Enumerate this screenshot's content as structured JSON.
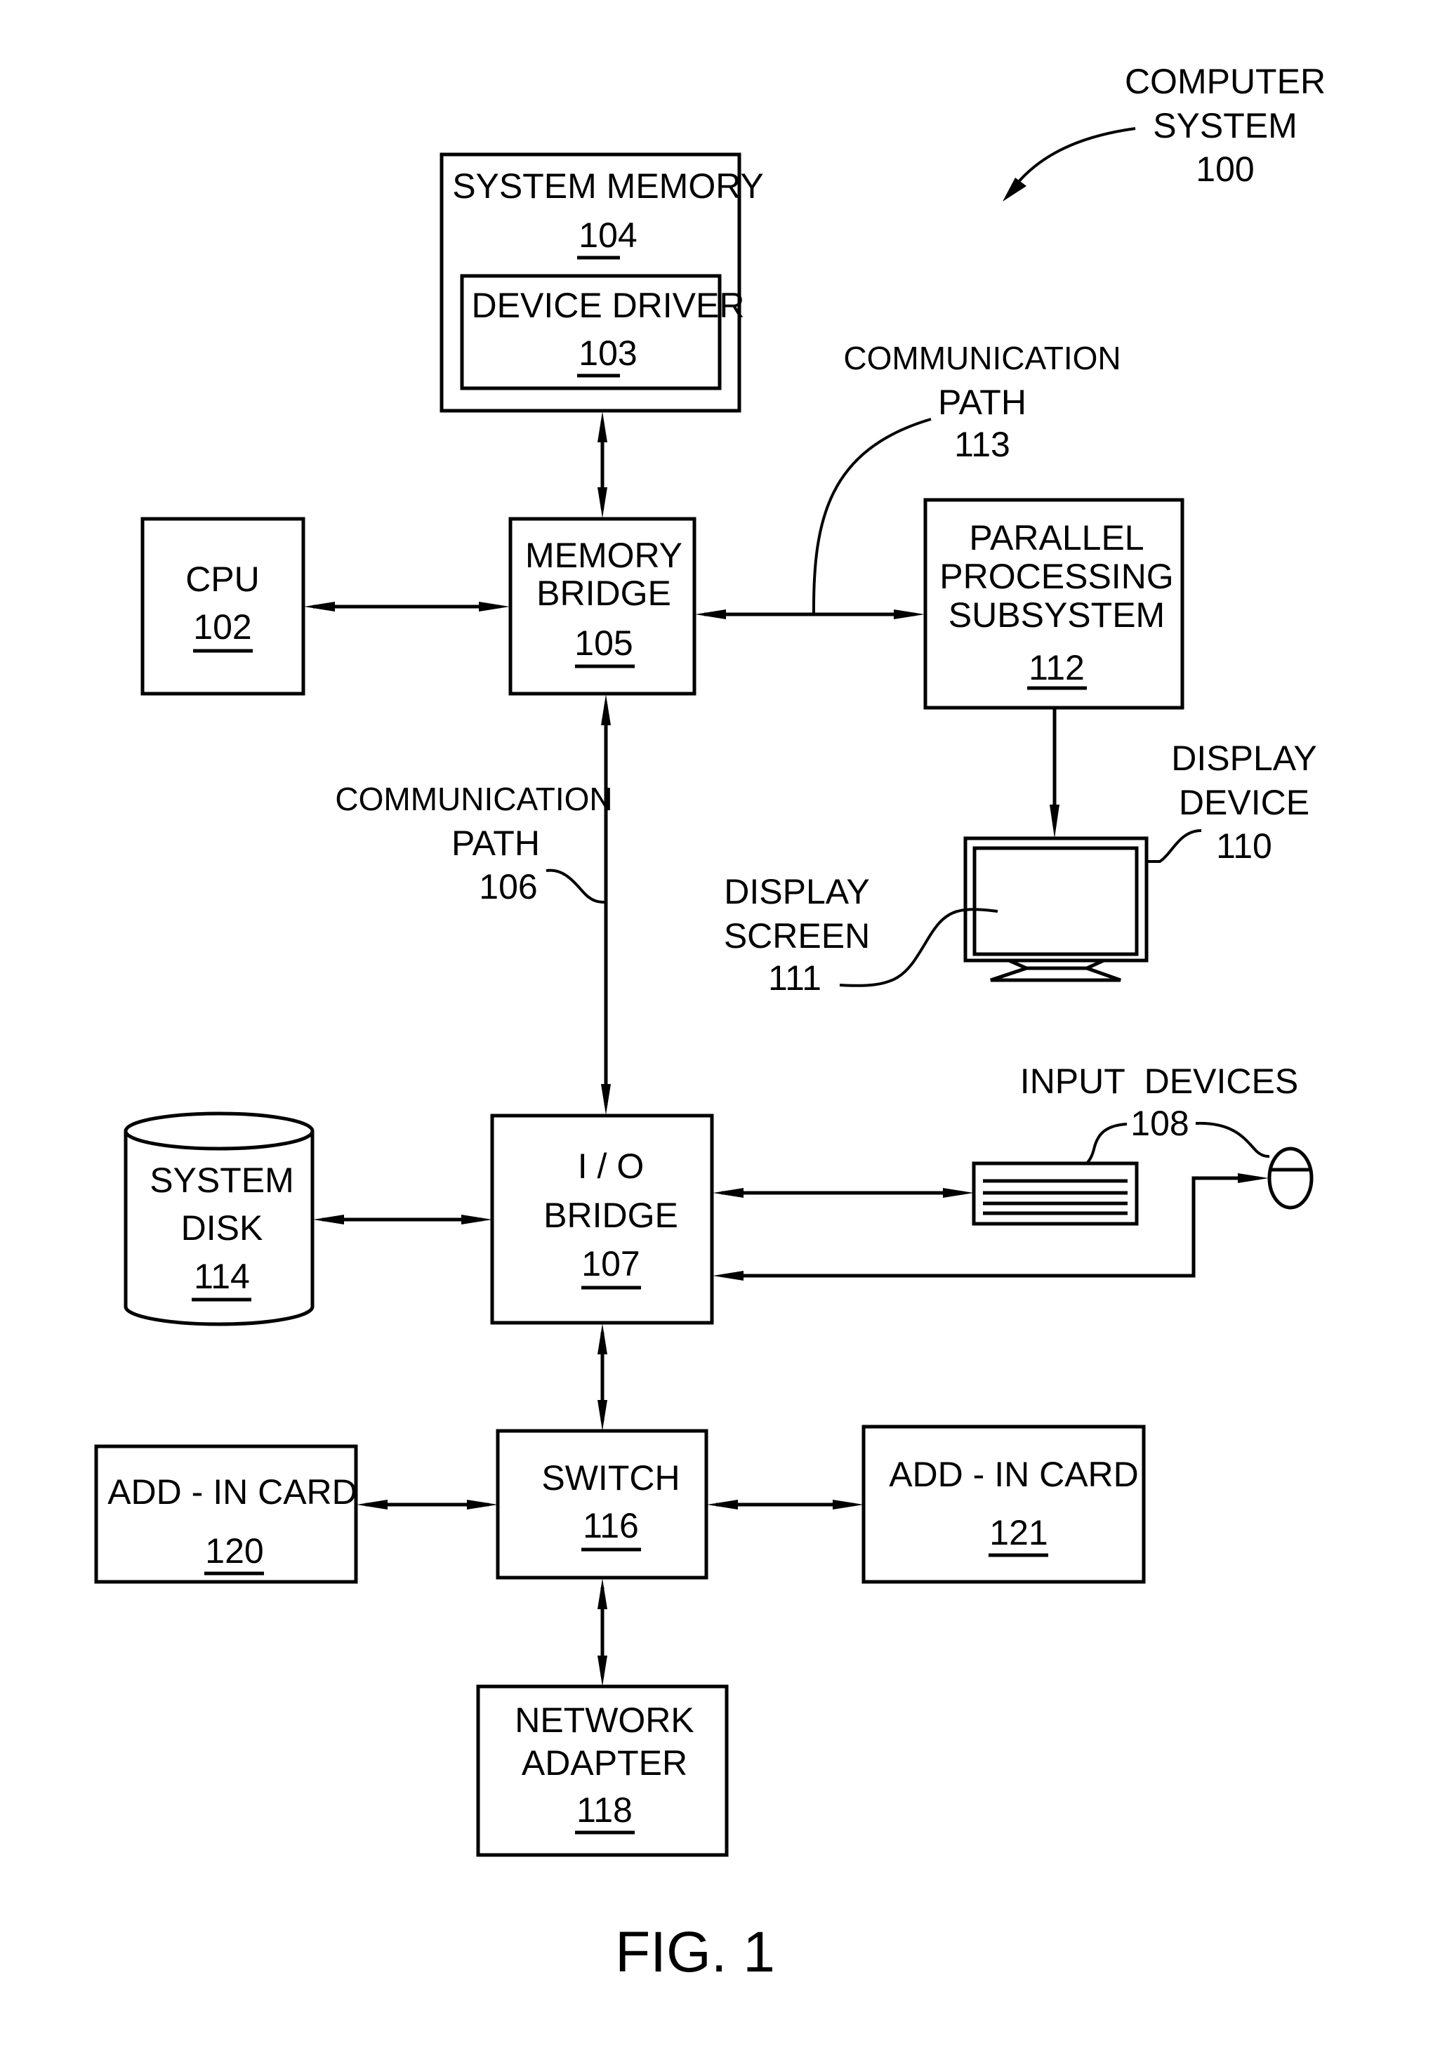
{
  "figure": {
    "caption": "FIG. 1",
    "system_label": [
      "COMPUTER",
      "SYSTEM",
      "100"
    ]
  },
  "components": {
    "system_memory": {
      "lines": [
        "SYSTEM MEMORY"
      ],
      "ref": "104"
    },
    "device_driver": {
      "lines": [
        "DEVICE DRIVER"
      ],
      "ref": "103"
    },
    "cpu": {
      "lines": [
        "CPU"
      ],
      "ref": "102"
    },
    "memory_bridge": {
      "lines": [
        "MEMORY",
        "BRIDGE"
      ],
      "ref": "105"
    },
    "parallel_processing": {
      "lines": [
        "PARALLEL",
        "PROCESSING",
        "SUBSYSTEM"
      ],
      "ref": "112"
    },
    "io_bridge": {
      "lines": [
        "I / O",
        "BRIDGE"
      ],
      "ref": "107"
    },
    "system_disk": {
      "lines": [
        "SYSTEM",
        "DISK"
      ],
      "ref": "114"
    },
    "switch": {
      "lines": [
        "SWITCH"
      ],
      "ref": "116"
    },
    "add_in_card_120": {
      "lines": [
        "ADD - IN CARD"
      ],
      "ref": "120"
    },
    "add_in_card_121": {
      "lines": [
        "ADD - IN CARD"
      ],
      "ref": "121"
    },
    "network_adapter": {
      "lines": [
        "NETWORK",
        "ADAPTER"
      ],
      "ref": "118"
    }
  },
  "callouts": {
    "comm_path_113": [
      "COMMUNICATION",
      "PATH",
      "113"
    ],
    "comm_path_106": [
      "COMMUNICATION",
      "PATH",
      "106"
    ],
    "display_device": [
      "DISPLAY",
      "DEVICE",
      "110"
    ],
    "display_screen": [
      "DISPLAY",
      "SCREEN",
      "111"
    ],
    "input_devices": [
      "INPUT  DEVICES",
      "108"
    ]
  },
  "icons": {
    "display_device": "monitor-icon",
    "keyboard": "keyboard-icon",
    "mouse": "mouse-icon",
    "system_disk": "cylinder-disk-icon"
  }
}
